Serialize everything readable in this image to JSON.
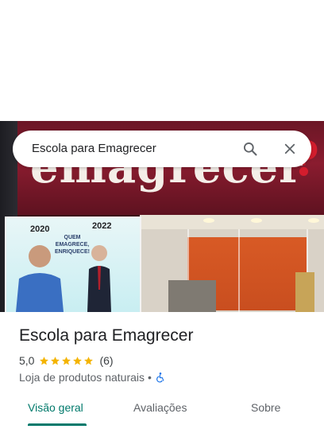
{
  "search": {
    "query": "Escola para Emagrecer",
    "search_icon": "search-icon",
    "close_icon": "close-icon"
  },
  "photo": {
    "sign_text": "emagrecer",
    "sign_question": "?",
    "banner": {
      "year_left": "2020",
      "year_right": "2022",
      "slogan": "QUEM EMAGRECE, ENRIQUECE!"
    }
  },
  "place": {
    "title": "Escola para Emagrecer",
    "rating": "5,0",
    "stars": 5,
    "review_count": "(6)",
    "category": "Loja de produtos naturais",
    "separator": "•",
    "accessibility_icon": "wheelchair-icon"
  },
  "tabs": [
    {
      "label": "Visão geral",
      "active": true
    },
    {
      "label": "Avaliações",
      "active": false
    },
    {
      "label": "Sobre",
      "active": false
    }
  ],
  "colors": {
    "accent": "#00796b",
    "star": "#f4b400",
    "accessibility": "#1a73e8",
    "sign": "#8a1c2f"
  }
}
